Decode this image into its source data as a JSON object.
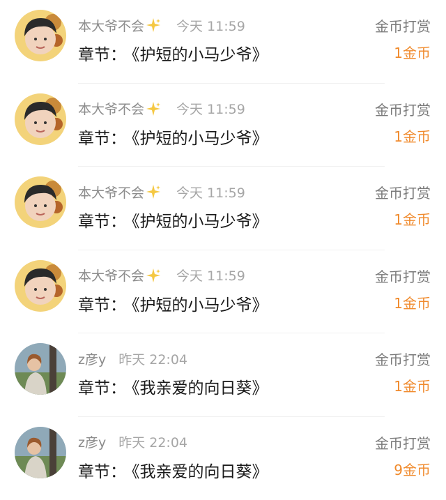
{
  "rewards": [
    {
      "user": "本大爷不会",
      "has_sparkle": true,
      "time": "今天 11:59",
      "chapter_label": "章节：",
      "chapter_title": "《护短的小马少爷》",
      "action": "金币打赏",
      "amount": "1金币",
      "avatar": "face-avatar"
    },
    {
      "user": "本大爷不会",
      "has_sparkle": true,
      "time": "今天 11:59",
      "chapter_label": "章节：",
      "chapter_title": "《护短的小马少爷》",
      "action": "金币打赏",
      "amount": "1金币",
      "avatar": "face-avatar"
    },
    {
      "user": "本大爷不会",
      "has_sparkle": true,
      "time": "今天 11:59",
      "chapter_label": "章节：",
      "chapter_title": "《护短的小马少爷》",
      "action": "金币打赏",
      "amount": "1金币",
      "avatar": "face-avatar"
    },
    {
      "user": "本大爷不会",
      "has_sparkle": true,
      "time": "今天 11:59",
      "chapter_label": "章节：",
      "chapter_title": "《护短的小马少爷》",
      "action": "金币打赏",
      "amount": "1金币",
      "avatar": "face-avatar"
    },
    {
      "user": "z彦y",
      "has_sparkle": false,
      "time": "昨天 22:04",
      "chapter_label": "章节：",
      "chapter_title": "《我亲爱的向日葵》",
      "action": "金币打赏",
      "amount": "1金币",
      "avatar": "painting-avatar"
    },
    {
      "user": "z彦y",
      "has_sparkle": false,
      "time": "昨天 22:04",
      "chapter_label": "章节：",
      "chapter_title": "《我亲爱的向日葵》",
      "action": "金币打赏",
      "amount": "9金币",
      "avatar": "painting-avatar"
    }
  ],
  "colors": {
    "amount": "#f08a2c",
    "sparkle": "#f5c842",
    "muted": "#8c8c8c"
  }
}
